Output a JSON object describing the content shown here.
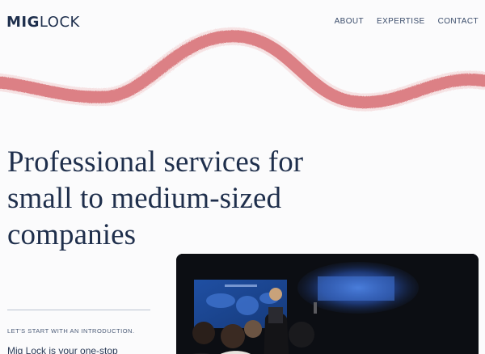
{
  "header": {
    "logo_part1": "MIG",
    "logo_part2": "LOCK",
    "nav": [
      {
        "label": "ABOUT"
      },
      {
        "label": "EXPERTISE"
      },
      {
        "label": "CONTACT"
      }
    ]
  },
  "hero": {
    "headline_line1": "Professional services for",
    "headline_line2": "small to medium-sized",
    "headline_line3": "companies"
  },
  "intro": {
    "label": "LET'S START WITH AN INTRODUCTION.",
    "text": "Mig Lock is your one-stop"
  },
  "colors": {
    "accent_wave": "#d66a6f",
    "text": "#1f2f4c",
    "background": "#fbfbfc"
  }
}
